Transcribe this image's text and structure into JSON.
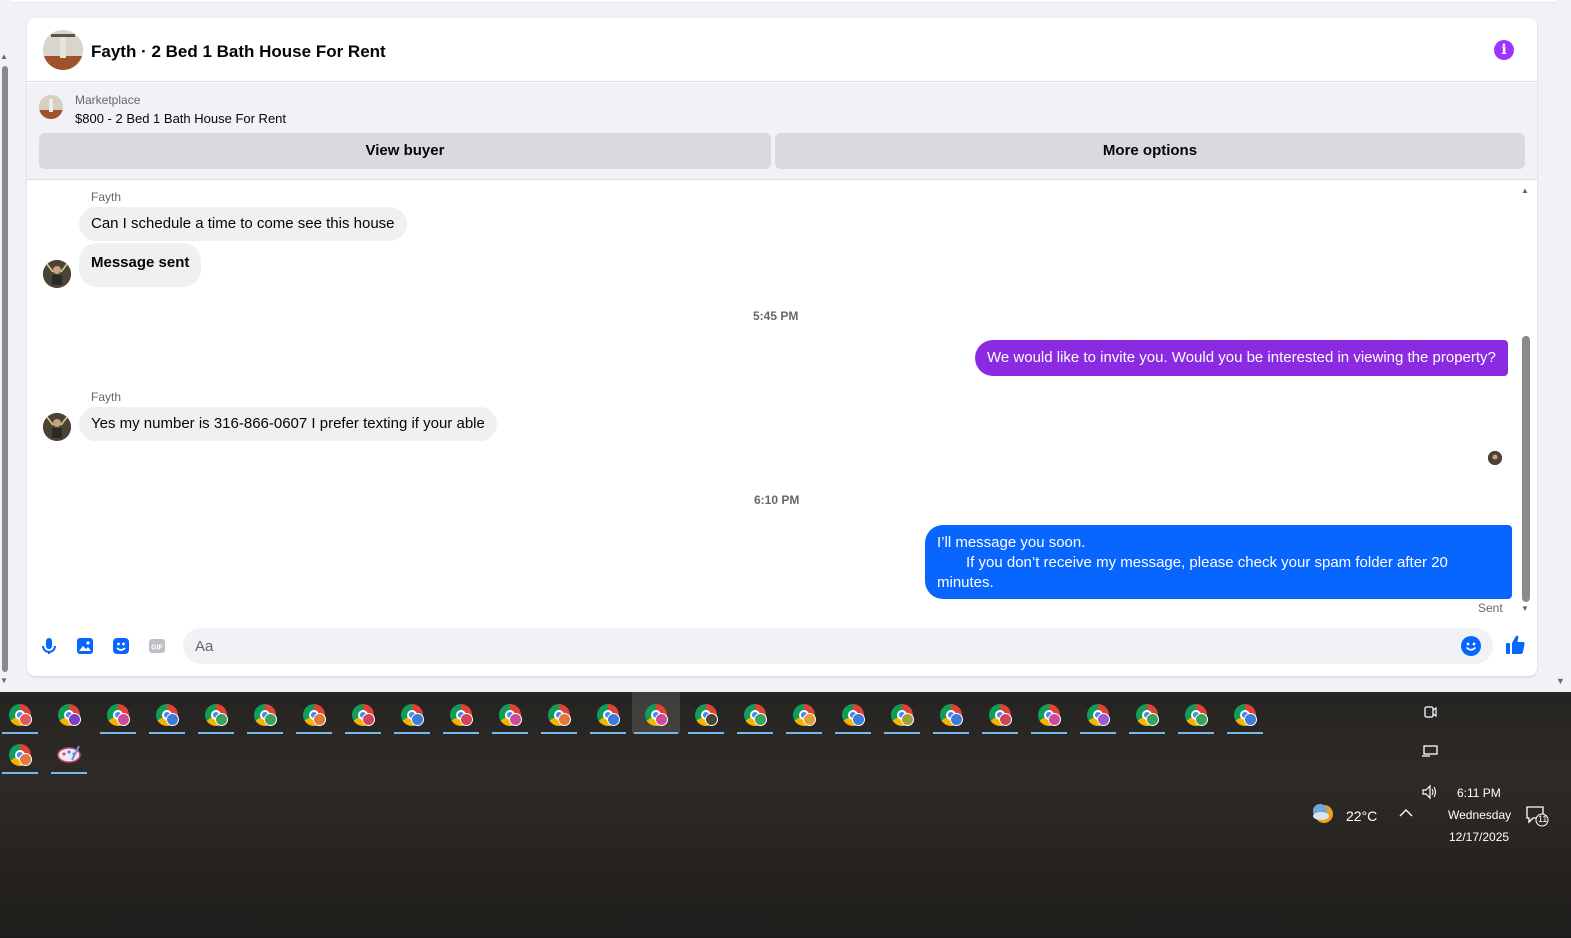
{
  "conversation": {
    "title": "Fayth · 2 Bed 1 Bath House For Rent",
    "marketplace_label": "Marketplace",
    "listing": "$800 - 2 Bed 1 Bath House For Rent",
    "view_buyer": "View buyer",
    "more_options": "More options"
  },
  "messages": {
    "sender_1": "Fayth",
    "msg_1": "Can I schedule a time to come see this house",
    "msg_2": "Message sent",
    "time_1": "5:45 PM",
    "msg_3": "We would like to invite you. Would you be interested in viewing the property?",
    "sender_2": "Fayth",
    "msg_4": "Yes my number is 316-866-0607 I prefer texting if your able",
    "time_2": "6:10 PM",
    "msg_5_line1": "I’ll message you soon.",
    "msg_5_line2": "If you don’t receive my message, please check your spam folder after 20",
    "msg_5_line3": "minutes.",
    "status": "Sent"
  },
  "composer": {
    "placeholder": "Aa"
  },
  "colors": {
    "accent_purple": "#8a2be2",
    "bubble_blue": "#0866ff",
    "info_icon": "#a033ff"
  },
  "taskbar": {
    "weather": "22°C",
    "time": "6:11 PM",
    "day": "Wednesday",
    "date": "12/17/2025",
    "notifications": "11"
  }
}
